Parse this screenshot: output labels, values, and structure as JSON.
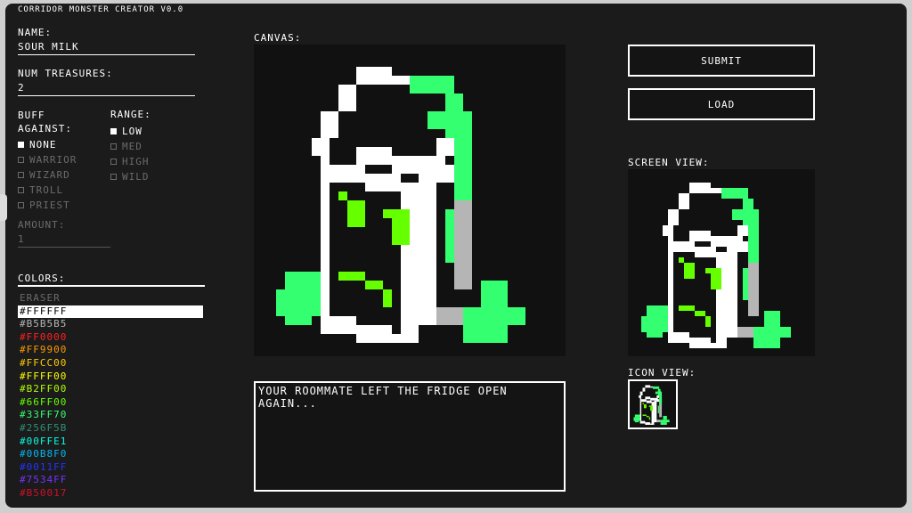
{
  "app": {
    "title": "CORRIDOR MONSTER CREATOR V0.0"
  },
  "form": {
    "name_label": "NAME:",
    "name_value": "SOUR MILK",
    "treasures_label": "NUM TREASURES:",
    "treasures_value": "2",
    "buff_label": "BUFF AGAINST:",
    "buff_options": [
      {
        "label": "NONE",
        "checked": true
      },
      {
        "label": "WARRIOR",
        "checked": false
      },
      {
        "label": "WIZARD",
        "checked": false
      },
      {
        "label": "TROLL",
        "checked": false
      },
      {
        "label": "PRIEST",
        "checked": false
      }
    ],
    "range_label": "RANGE:",
    "range_options": [
      {
        "label": "LOW",
        "checked": true
      },
      {
        "label": "MED",
        "checked": false
      },
      {
        "label": "HIGH",
        "checked": false
      },
      {
        "label": "WILD",
        "checked": false
      }
    ],
    "amount_label": "AMOUNT:",
    "amount_value": "1"
  },
  "colors": {
    "label": "COLORS:",
    "items": [
      {
        "label": "ERASER",
        "color": "#6b6b6b",
        "selected": false
      },
      {
        "label": "#FFFFFF",
        "color": "#000000",
        "selected": true
      },
      {
        "label": "#B5B5B5",
        "color": "#b5b5b5",
        "selected": false
      },
      {
        "label": "#FF0000",
        "color": "#ff2020",
        "selected": false
      },
      {
        "label": "#FF9900",
        "color": "#ff9900",
        "selected": false
      },
      {
        "label": "#FFCC00",
        "color": "#ffcc00",
        "selected": false
      },
      {
        "label": "#FFFF00",
        "color": "#ffff00",
        "selected": false
      },
      {
        "label": "#B2FF00",
        "color": "#b2ff00",
        "selected": false
      },
      {
        "label": "#66FF00",
        "color": "#66ff00",
        "selected": false
      },
      {
        "label": "#33FF70",
        "color": "#33ff70",
        "selected": false
      },
      {
        "label": "#256F5B",
        "color": "#2f8f74",
        "selected": false
      },
      {
        "label": "#00FFE1",
        "color": "#00ffe1",
        "selected": false
      },
      {
        "label": "#00B8F0",
        "color": "#00b8f0",
        "selected": false
      },
      {
        "label": "#0011FF",
        "color": "#2233ff",
        "selected": false
      },
      {
        "label": "#7534FF",
        "color": "#7534ff",
        "selected": false
      },
      {
        "label": "#B50017",
        "color": "#d0102a",
        "selected": false
      }
    ]
  },
  "canvas": {
    "label": "CANVAS:"
  },
  "description": {
    "text": "YOUR ROOMMATE LEFT THE FRIDGE OPEN\nAGAIN..."
  },
  "buttons": {
    "submit": "SUBMIT",
    "load": "LOAD"
  },
  "screen_view": {
    "label": "SCREEN VIEW:"
  },
  "icon_view": {
    "label": "ICON VIEW:"
  },
  "sprite_palette": {
    "white": "#ffffff",
    "gray": "#b5b5b5",
    "green": "#33ff70",
    "lime": "#66ff00"
  }
}
